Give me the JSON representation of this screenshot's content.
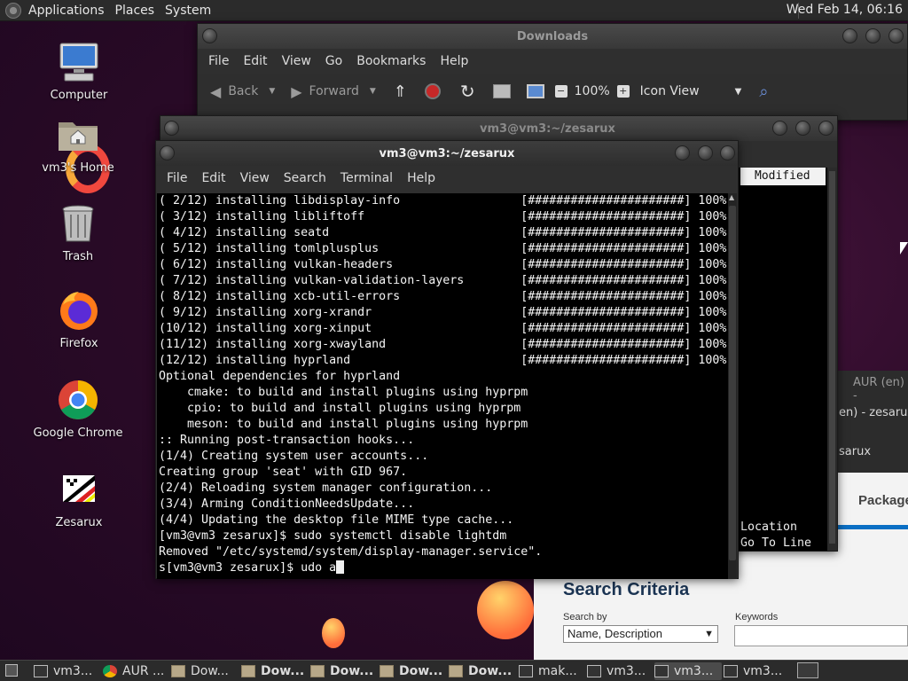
{
  "top_panel": {
    "menus": [
      "Applications",
      "Places",
      "System"
    ],
    "clock": "Wed Feb 14, 06:16"
  },
  "desktop": {
    "icons": [
      {
        "label": "Computer",
        "icon": "computer-icon"
      },
      {
        "label": "vm3's Home",
        "icon": "home-folder-icon"
      },
      {
        "label": "Trash",
        "icon": "trash-icon"
      },
      {
        "label": "Firefox",
        "icon": "firefox-icon"
      },
      {
        "label": "Google Chrome",
        "icon": "chrome-icon"
      },
      {
        "label": "Zesarux",
        "icon": "zesarux-icon"
      }
    ]
  },
  "file_manager": {
    "title": "Downloads",
    "menu": [
      "File",
      "Edit",
      "View",
      "Go",
      "Bookmarks",
      "Help"
    ],
    "toolbar": {
      "back": "Back",
      "forward": "Forward",
      "zoom": "100%",
      "view_mode": "Icon View"
    }
  },
  "bg_terminal": {
    "title": "vm3@vm3:~/zesarux",
    "column_header": "Modified",
    "line1": "Location",
    "line2": "Go To Line"
  },
  "aur_window": {
    "title": "AUR (en) -",
    "line1": "en) - zesarux",
    "line2": "sarux",
    "packages_label": "Package",
    "search_criteria": "Search Criteria",
    "search_by_label": "Search by",
    "search_by_value": "Name, Description",
    "keywords_label": "Keywords"
  },
  "terminal": {
    "title": "vm3@vm3:~/zesarux",
    "menu": [
      "File",
      "Edit",
      "View",
      "Search",
      "Terminal",
      "Help"
    ],
    "lines": [
      "( 2/12) installing libdisplay-info                 [######################] 100%",
      "( 3/12) installing libliftoff                      [######################] 100%",
      "( 4/12) installing seatd                           [######################] 100%",
      "( 5/12) installing tomlplusplus                    [######################] 100%",
      "( 6/12) installing vulkan-headers                  [######################] 100%",
      "( 7/12) installing vulkan-validation-layers        [######################] 100%",
      "( 8/12) installing xcb-util-errors                 [######################] 100%",
      "( 9/12) installing xorg-xrandr                     [######################] 100%",
      "(10/12) installing xorg-xinput                     [######################] 100%",
      "(11/12) installing xorg-xwayland                   [######################] 100%",
      "(12/12) installing hyprland                        [######################] 100%",
      "Optional dependencies for hyprland",
      "    cmake: to build and install plugins using hyprpm",
      "    cpio: to build and install plugins using hyprpm",
      "    meson: to build and install plugins using hyprpm",
      ":: Running post-transaction hooks...",
      "(1/4) Creating system user accounts...",
      "Creating group 'seat' with GID 967.",
      "(2/4) Reloading system manager configuration...",
      "(3/4) Arming ConditionNeedsUpdate...",
      "(4/4) Updating the desktop file MIME type cache...",
      "[vm3@vm3 zesarux]$ sudo systemctl disable lightdm",
      "Removed \"/etc/systemd/system/display-manager.service\"."
    ],
    "prompt_line": "s[vm3@vm3 zesarux]$ udo a"
  },
  "taskbar": {
    "items": [
      {
        "label": "vm3...",
        "icon": "terminal-icon",
        "bold": false
      },
      {
        "label": "AUR ...",
        "icon": "chrome-icon",
        "bold": false
      },
      {
        "label": "Dow...",
        "icon": "folder-icon",
        "bold": false
      },
      {
        "label": "Dow...",
        "icon": "folder-icon",
        "bold": true
      },
      {
        "label": "Dow...",
        "icon": "folder-icon",
        "bold": true
      },
      {
        "label": "Dow...",
        "icon": "folder-icon",
        "bold": true
      },
      {
        "label": "Dow...",
        "icon": "folder-icon",
        "bold": true
      },
      {
        "label": "mak...",
        "icon": "app-icon",
        "bold": false
      },
      {
        "label": "vm3...",
        "icon": "terminal-icon",
        "bold": false
      },
      {
        "label": "vm3...",
        "icon": "terminal-icon",
        "bold": false,
        "active": true
      },
      {
        "label": "vm3...",
        "icon": "terminal-icon",
        "bold": false
      }
    ]
  }
}
